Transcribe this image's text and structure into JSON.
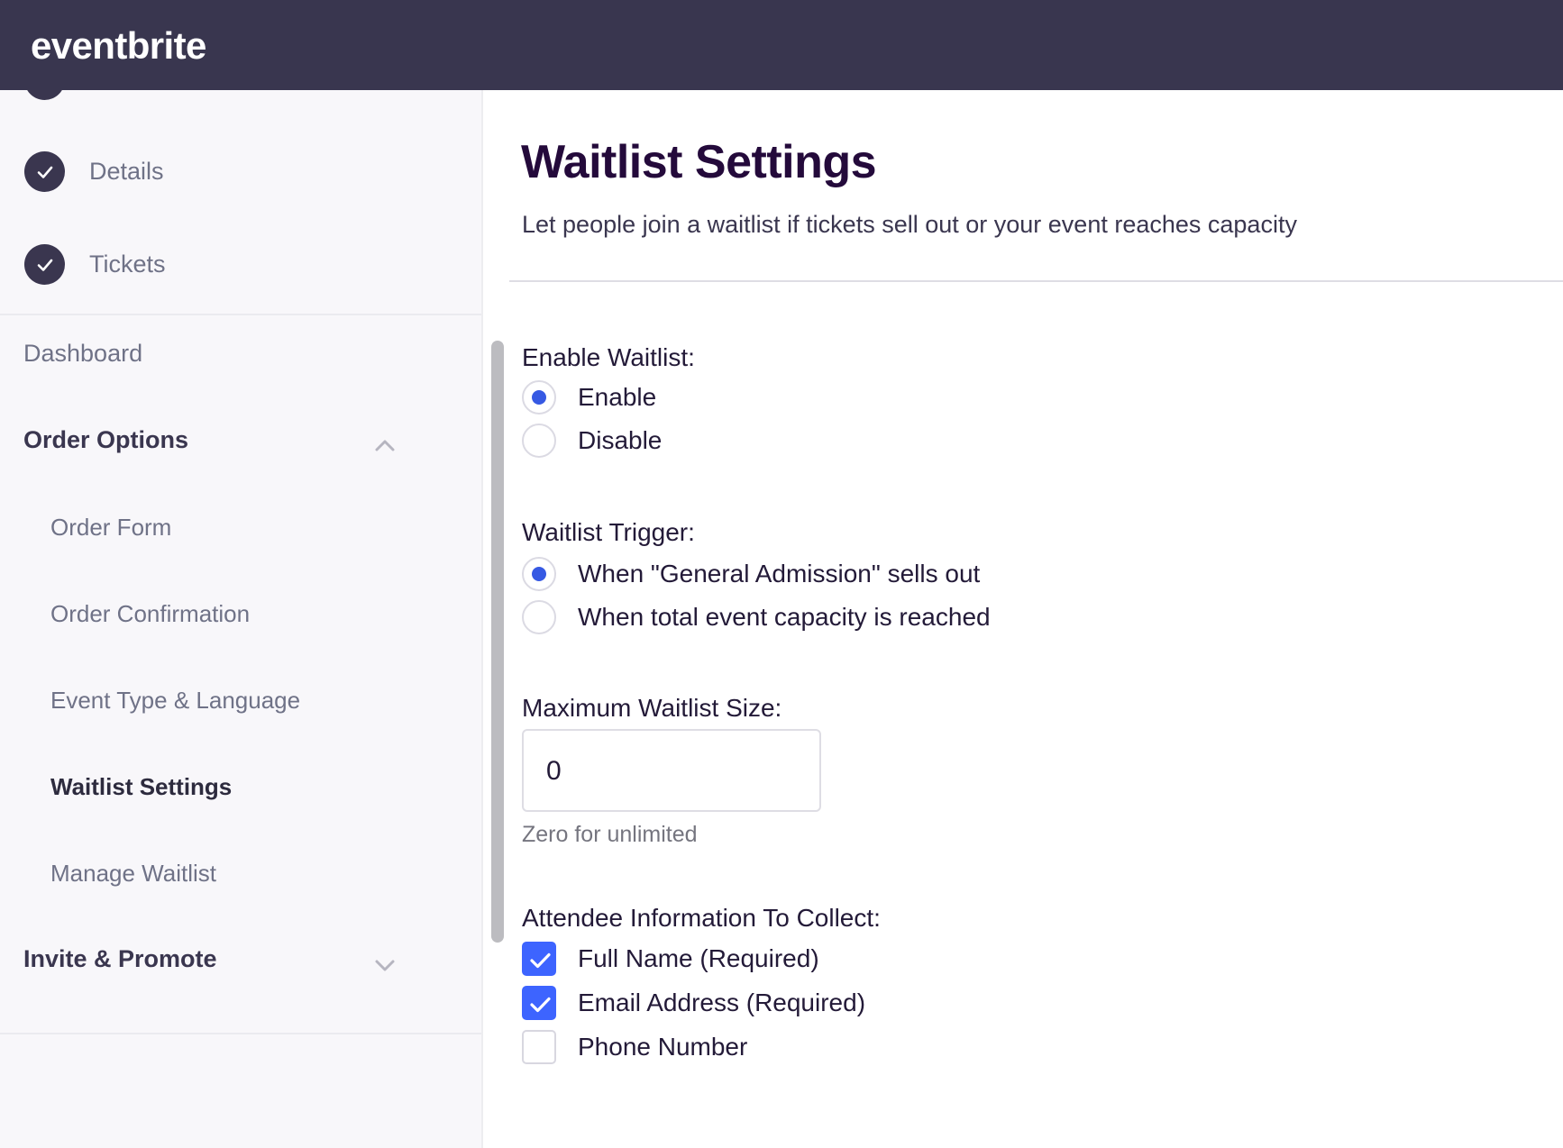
{
  "header": {
    "logo_text": "eventbrite",
    "bg": "#39364F"
  },
  "sidebar": {
    "steps": [
      {
        "label": "Details",
        "state": "complete"
      },
      {
        "label": "Tickets",
        "state": "complete"
      }
    ],
    "dashboard_label": "Dashboard",
    "groups": [
      {
        "label": "Order Options",
        "expanded": true,
        "chevron": "chevron-up-icon",
        "items": [
          {
            "label": "Order Form",
            "active": false
          },
          {
            "label": "Order Confirmation",
            "active": false
          },
          {
            "label": "Event Type & Language",
            "active": false
          },
          {
            "label": "Waitlist Settings",
            "active": true
          },
          {
            "label": "Manage Waitlist",
            "active": false
          }
        ]
      },
      {
        "label": "Invite & Promote",
        "expanded": false,
        "chevron": "chevron-down-icon",
        "items": []
      }
    ]
  },
  "main": {
    "title": "Waitlist Settings",
    "subtitle": "Let people join a waitlist if tickets sell out or your event reaches capacity",
    "enable_waitlist": {
      "label": "Enable Waitlist:",
      "options": [
        {
          "label": "Enable",
          "selected": true
        },
        {
          "label": "Disable",
          "selected": false
        }
      ]
    },
    "waitlist_trigger": {
      "label": "Waitlist Trigger:",
      "options": [
        {
          "label": "When \"General Admission\" sells out",
          "selected": true
        },
        {
          "label": "When total event capacity is reached",
          "selected": false
        }
      ]
    },
    "max_waitlist_size": {
      "label": "Maximum Waitlist Size:",
      "value": "0",
      "placeholder": "0",
      "hint": "Zero for unlimited"
    },
    "attendee_info": {
      "label": "Attendee Information To Collect:",
      "options": [
        {
          "label": "Full Name (Required)",
          "checked": true
        },
        {
          "label": "Email Address (Required)",
          "checked": true
        },
        {
          "label": "Phone Number",
          "checked": false
        }
      ]
    }
  },
  "colors": {
    "brand_dark": "#39364F",
    "accent_blue": "#3659E3",
    "checkbox_blue": "#3D64FF",
    "title_purple": "#240A3B",
    "sidebar_bg": "#F8F7FA"
  }
}
